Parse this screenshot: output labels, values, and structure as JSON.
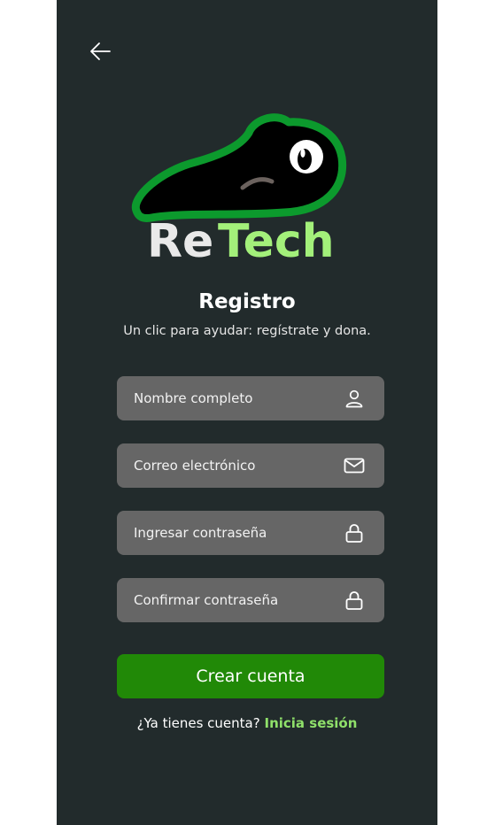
{
  "colors": {
    "background": "#222b2c",
    "field": "#666666",
    "primary_button": "#218907",
    "link": "#8fe06a",
    "logo_green": "#0c9a2d",
    "logo_light_green": "#a3f07a"
  },
  "logo": {
    "text_re": "Re",
    "text_tech": "Tech"
  },
  "header": {
    "title": "Registro",
    "subtitle": "Un clic para ayudar: regístrate y dona."
  },
  "form": {
    "fields": [
      {
        "label": "Nombre completo",
        "icon": "user-icon"
      },
      {
        "label": "Correo electrónico",
        "icon": "mail-icon"
      },
      {
        "label": "Ingresar contraseña",
        "icon": "lock-icon"
      },
      {
        "label": "Confirmar contraseña",
        "icon": "lock-icon"
      }
    ],
    "submit_label": "Crear cuenta"
  },
  "footer": {
    "prompt": "¿Ya tienes cuenta?",
    "link": "Inicia sesión"
  }
}
